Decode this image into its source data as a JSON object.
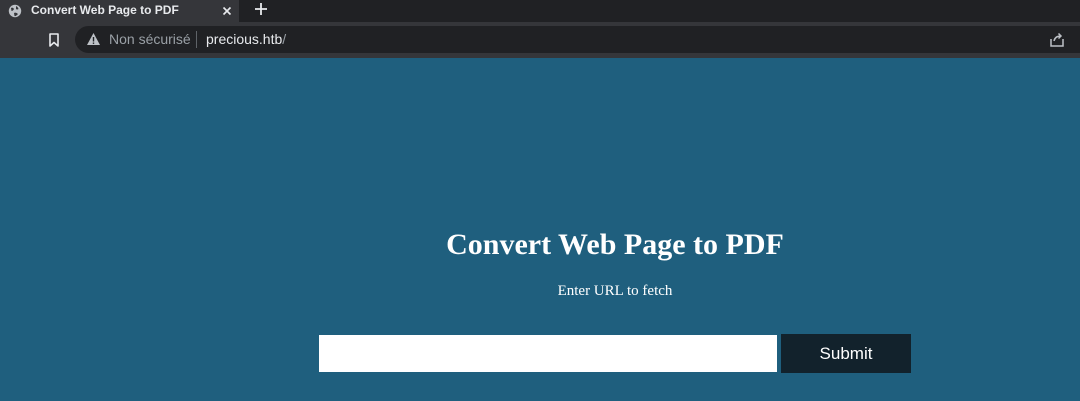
{
  "browser": {
    "tab": {
      "title": "Convert Web Page to PDF",
      "favicon": "globe-icon"
    },
    "address_bar": {
      "security_label": "Non sécurisé",
      "url_host": "precious.htb",
      "url_path": "/"
    }
  },
  "page": {
    "title": "Convert Web Page to PDF",
    "subtitle": "Enter URL to fetch",
    "url_input": {
      "value": "",
      "placeholder": ""
    },
    "submit_label": "Submit"
  },
  "colors": {
    "page_background": "#1f5f7e",
    "button_background": "#12222c",
    "chrome_dark": "#202124",
    "chrome_mid": "#35363a"
  }
}
